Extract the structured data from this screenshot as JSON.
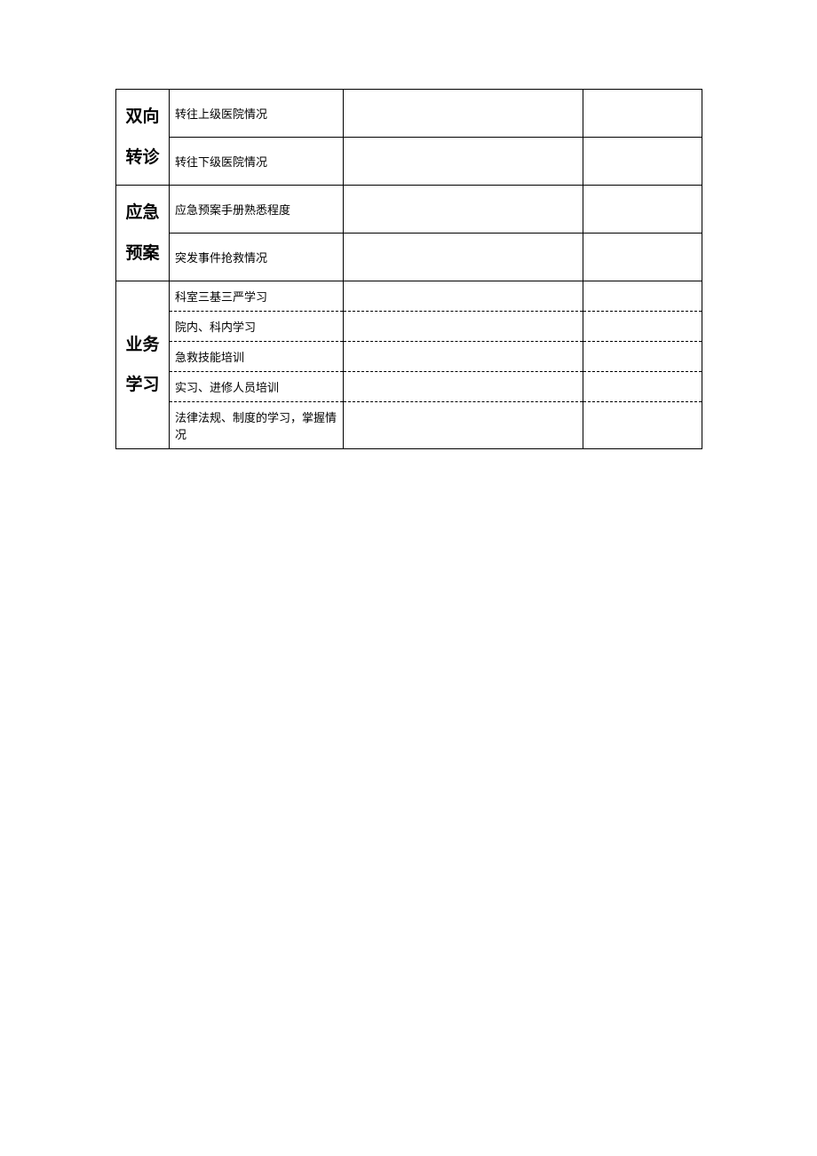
{
  "sections": [
    {
      "category": "双向转诊",
      "rows": [
        {
          "item": "转往上级医院情况",
          "c3": "",
          "c4": ""
        },
        {
          "item": "转往下级医院情况",
          "c3": "",
          "c4": ""
        }
      ]
    },
    {
      "category": "应急预案",
      "rows": [
        {
          "item": "应急预案手册熟悉程度",
          "c3": "",
          "c4": ""
        },
        {
          "item": "突发事件抢救情况",
          "c3": "",
          "c4": ""
        }
      ]
    },
    {
      "category": "业务学习",
      "rows": [
        {
          "item": "科室三基三严学习",
          "c3": "",
          "c4": ""
        },
        {
          "item": "院内、科内学习",
          "c3": "",
          "c4": ""
        },
        {
          "item": "急救技能培训",
          "c3": "",
          "c4": ""
        },
        {
          "item": "实习、进修人员培训",
          "c3": "",
          "c4": ""
        },
        {
          "item": "法律法规、制度的学习，掌握情况",
          "c3": "",
          "c4": ""
        }
      ]
    }
  ]
}
